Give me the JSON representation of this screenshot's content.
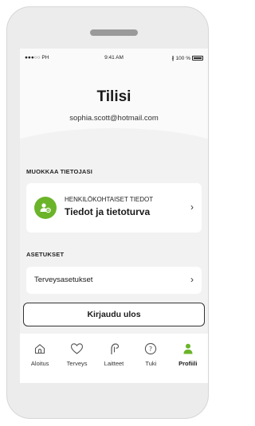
{
  "status_bar": {
    "carrier": "●●●○○ PH",
    "time": "9:41 AM",
    "battery": "100 %"
  },
  "header": {
    "title": "Tilisi",
    "email": "sophia.scott@hotmail.com"
  },
  "edit_section": {
    "label": "MUOKKAA TIETOJASI",
    "personal_card": {
      "small_label": "HENKILÖKOHTAISET TIEDOT",
      "title": "Tiedot ja tietoturva",
      "icon": "user-gear-icon"
    }
  },
  "settings_section": {
    "label": "ASETUKSET",
    "health_item": {
      "label": "Terveysasetukset"
    }
  },
  "logout_button": {
    "label": "Kirjaudu ulos"
  },
  "tabbar": {
    "tabs": [
      {
        "label": "Aloitus",
        "icon": "home-icon"
      },
      {
        "label": "Terveys",
        "icon": "heart-icon"
      },
      {
        "label": "Laitteet",
        "icon": "hearing-aid-icon"
      },
      {
        "label": "Tuki",
        "icon": "help-icon"
      },
      {
        "label": "Profiili",
        "icon": "profile-icon",
        "active": true
      }
    ]
  },
  "colors": {
    "accent": "#6bb42a",
    "background": "#f2f2f2",
    "card": "#ffffff"
  }
}
